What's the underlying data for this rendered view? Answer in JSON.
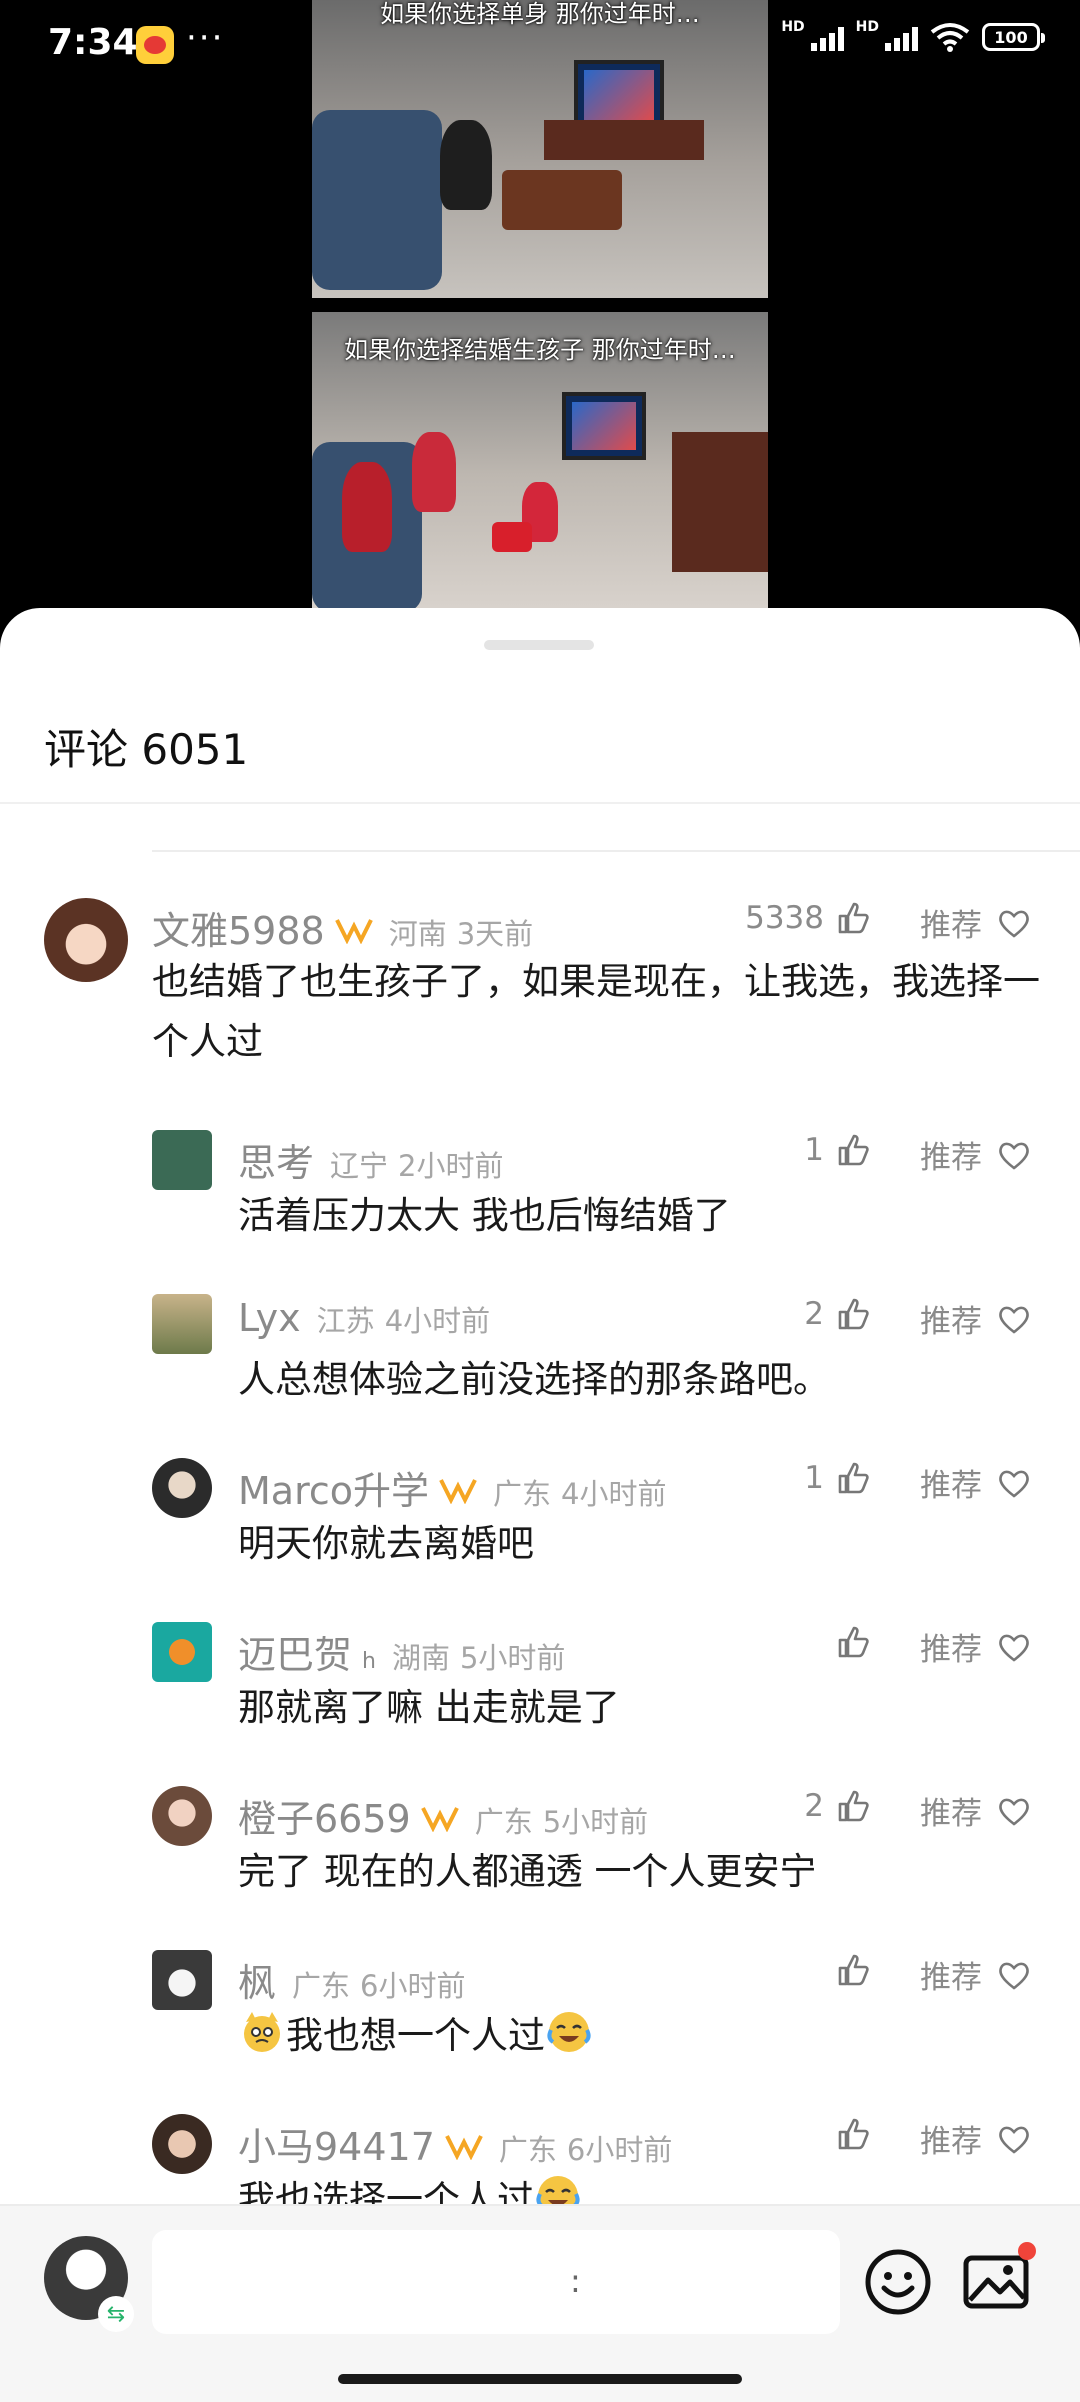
{
  "status_bar": {
    "time": "7:34",
    "dots": "···",
    "hd1": "HD",
    "hd2": "HD",
    "battery": "100",
    "app_icon": "weibo-icon"
  },
  "video": {
    "caption_top": "如果你选择单身 那你过年时…",
    "caption_bottom": "如果你选择结婚生孩子 那你过年时…"
  },
  "sheet": {
    "title": "评论 6051"
  },
  "comments": [
    {
      "user": "文雅5988",
      "badge": true,
      "location": "河南",
      "time": "3天前",
      "likes": "5338",
      "recommend": "推荐",
      "text": "也结婚了也生孩子了，如果是现在，让我选，我选择一个人过"
    },
    {
      "user": "思考",
      "badge": false,
      "location": "辽宁",
      "time": "2小时前",
      "likes": "1",
      "recommend": "推荐",
      "text": "活着压力太大 我也后悔结婚了"
    },
    {
      "user": "Lyx",
      "badge": false,
      "location": "江苏",
      "time": "4小时前",
      "likes": "2",
      "recommend": "推荐",
      "text": "人总想体验之前没选择的那条路吧。"
    },
    {
      "user": "Marco升学",
      "badge": true,
      "location": "广东",
      "time": "4小时前",
      "likes": "1",
      "recommend": "推荐",
      "text": "明天你就去离婚吧"
    },
    {
      "user": "迈巴贺",
      "badge": false,
      "extra": "h",
      "location": "湖南",
      "time": "5小时前",
      "likes": "",
      "recommend": "推荐",
      "text": "那就离了嘛 出走就是了"
    },
    {
      "user": "橙子6659",
      "badge": true,
      "location": "广东",
      "time": "5小时前",
      "likes": "2",
      "recommend": "推荐",
      "text": "完了 现在的人都通透 一个人更安宁"
    },
    {
      "user": "枫",
      "badge": false,
      "location": "广东",
      "time": "6小时前",
      "likes": "",
      "recommend": "推荐",
      "text": "我也想一个人过"
    },
    {
      "user": "小马94417",
      "badge": true,
      "location": "广东",
      "time": "6小时前",
      "likes": "",
      "recommend": "推荐",
      "text": "我也选择一个人过"
    }
  ],
  "bottom_bar": {
    "input_placeholder": "",
    "input_colon": ":",
    "icons": [
      "emoji-icon",
      "image-icon"
    ]
  },
  "colors": {
    "badge": "#f5a623",
    "muted": "#8a8a8a",
    "notification": "#f0443a"
  }
}
